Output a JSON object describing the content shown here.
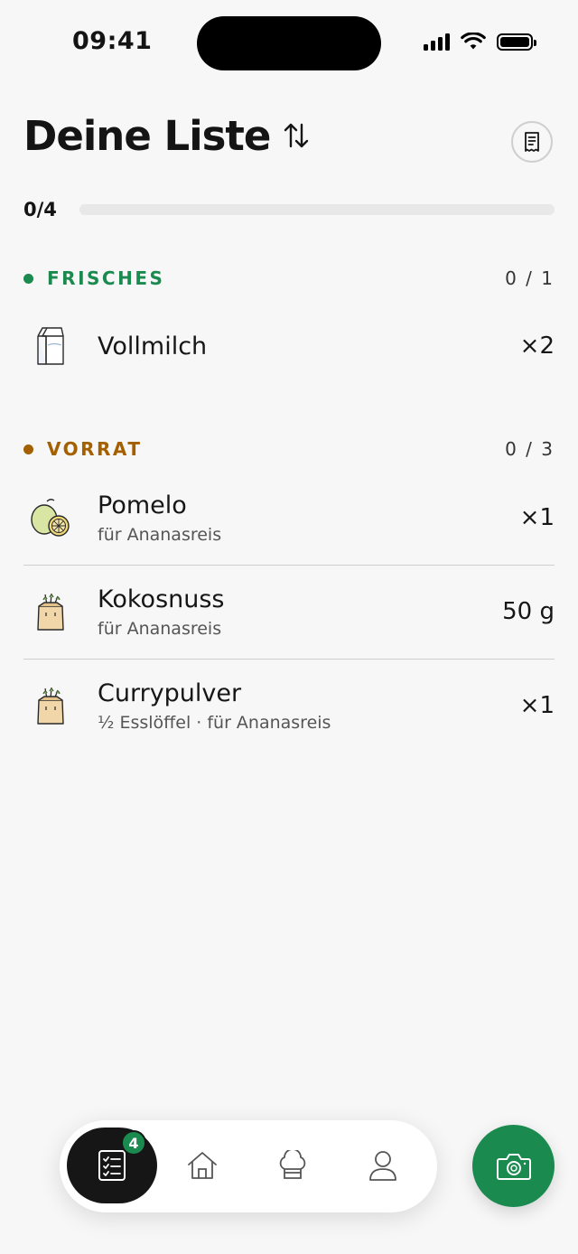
{
  "status_bar": {
    "time": "09:41"
  },
  "header": {
    "title": "Deine Liste",
    "sort_icon": "sort-arrows-icon",
    "receipt_icon": "receipt-icon"
  },
  "progress": {
    "label": "0/4",
    "completed": 0,
    "total": 4
  },
  "colors": {
    "green": "#1a8a4f",
    "amber": "#a35f00"
  },
  "sections": [
    {
      "title": "FRISCHES",
      "count": "0 / 1",
      "items": [
        {
          "name": "Vollmilch",
          "quantity": "×2",
          "icon": "milk-carton-icon"
        }
      ]
    },
    {
      "title": "VORRAT",
      "count": "0 / 3",
      "items": [
        {
          "name": "Pomelo",
          "subtitle": "für Ananasreis",
          "quantity": "×1",
          "icon": "pomelo-icon"
        },
        {
          "name": "Kokosnuss",
          "subtitle": "für Ananasreis",
          "quantity": "50 g",
          "icon": "grocery-bag-icon"
        },
        {
          "name": "Currypulver",
          "subtitle": "½ Esslöffel · für Ananasreis",
          "quantity": "×1",
          "icon": "grocery-bag-icon"
        }
      ]
    }
  ],
  "bottom_nav": {
    "items": [
      {
        "icon": "checklist-icon",
        "active": true,
        "badge": "4"
      },
      {
        "icon": "home-icon",
        "active": false
      },
      {
        "icon": "chef-hat-icon",
        "active": false
      },
      {
        "icon": "profile-icon",
        "active": false
      }
    ],
    "fab_icon": "camera-icon"
  }
}
